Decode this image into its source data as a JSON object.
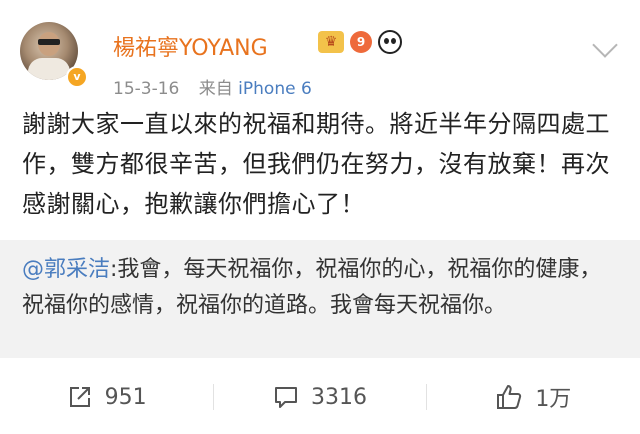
{
  "post": {
    "author": "楊祐寧YOYANG",
    "date": "15-3-16",
    "source_prefix": "来自",
    "source": "iPhone 6",
    "level": "9",
    "verified_mark": "v",
    "text": "謝謝大家一直以來的祝福和期待。將近半年分隔四處工作，雙方都很辛苦，但我們仍在努力，沒有放棄！再次感謝關心，抱歉讓你們擔心了！"
  },
  "quote": {
    "mention": "@郭采洁",
    "text": ":我會，每天祝福你，祝福你的心，祝福你的健康，祝福你的感情，祝福你的道路。我會每天祝福你。"
  },
  "actions": {
    "repost_count": "951",
    "comment_count": "3316",
    "like_count": "1万"
  },
  "colors": {
    "username": "#e8731e",
    "link": "#4a7dbf",
    "quote_bg": "#f2f2f2"
  },
  "icons": [
    "share-icon",
    "comment-icon",
    "thumbs-up-icon",
    "chevron-down-icon",
    "crown-badge-icon",
    "level-badge-icon",
    "panda-icon",
    "verified-badge-icon"
  ]
}
